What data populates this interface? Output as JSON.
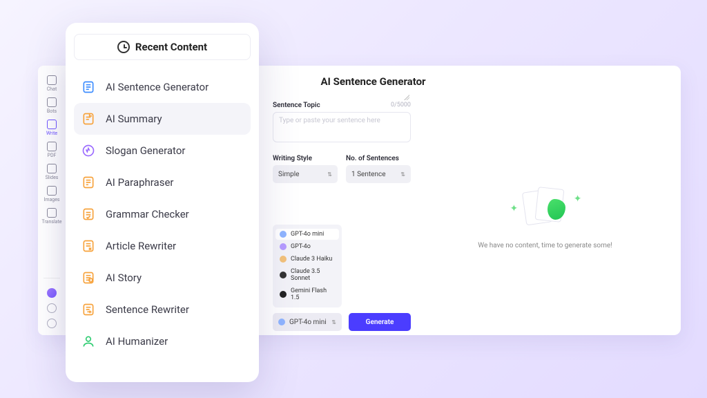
{
  "rail": {
    "items": [
      {
        "label": "Chat"
      },
      {
        "label": "Bots"
      },
      {
        "label": "Write"
      },
      {
        "label": "PDF"
      },
      {
        "label": "Slides"
      },
      {
        "label": "Images"
      },
      {
        "label": "Translate"
      }
    ],
    "active_index": 2
  },
  "main": {
    "title": "AI Sentence Generator",
    "topic": {
      "label": "Sentence Topic",
      "counter": "0/5000",
      "placeholder": "Type or paste your sentence here",
      "value": ""
    },
    "style": {
      "label": "Writing Style",
      "value": "Simple"
    },
    "count": {
      "label": "No. of Sentences",
      "value": "1 Sentence"
    },
    "models": {
      "options": [
        {
          "name": "GPT-4o mini",
          "color": "#8fb4ff"
        },
        {
          "name": "GPT-4o",
          "color": "#b59bff"
        },
        {
          "name": "Claude 3 Haiku",
          "color": "#f3c27a"
        },
        {
          "name": "Claude 3.5 Sonnet",
          "color": "#333333"
        },
        {
          "name": "Gemini Flash 1.5",
          "color": "#222222"
        }
      ],
      "selected": "GPT-4o mini",
      "selected_index": 0
    },
    "generate_label": "Generate",
    "empty_state": "We have no content, time to generate some!"
  },
  "popup": {
    "header": "Recent Content",
    "tools": [
      {
        "label": "AI Sentence Generator",
        "color": "#3c8cff"
      },
      {
        "label": "AI Summary",
        "color": "#f7a23b"
      },
      {
        "label": "Slogan Generator",
        "color": "#9b6bff"
      },
      {
        "label": "AI Paraphraser",
        "color": "#f7a23b"
      },
      {
        "label": "Grammar Checker",
        "color": "#f7a23b"
      },
      {
        "label": "Article Rewriter",
        "color": "#f7a23b"
      },
      {
        "label": "AI Story",
        "color": "#f7a23b"
      },
      {
        "label": "Sentence Rewriter",
        "color": "#f7a23b"
      },
      {
        "label": "AI Humanizer",
        "color": "#2ecc71"
      }
    ],
    "hover_index": 1
  }
}
